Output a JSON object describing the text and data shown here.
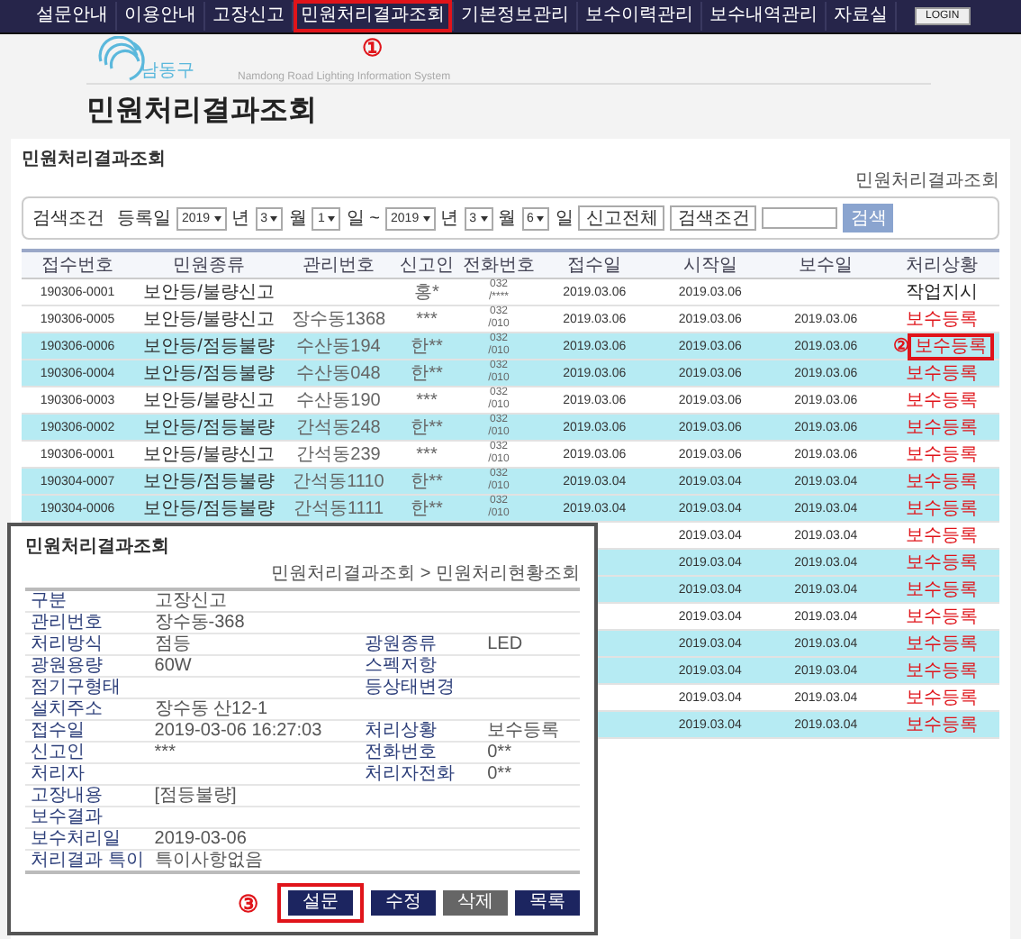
{
  "nav": {
    "items": [
      {
        "label": "설문안내",
        "outlined": false
      },
      {
        "label": "이용안내",
        "outlined": false
      },
      {
        "label": "고장신고",
        "outlined": false
      },
      {
        "label": "민원처리결과조회",
        "outlined": true
      },
      {
        "label": "기본정보관리",
        "outlined": false
      },
      {
        "label": "보수이력관리",
        "outlined": false
      },
      {
        "label": "보수내역관리",
        "outlined": false
      },
      {
        "label": "자료실",
        "outlined": false
      }
    ],
    "login": "LOGIN"
  },
  "markers": [
    "①",
    "②",
    "③"
  ],
  "logo": {
    "name": "남동구",
    "tagline": "Namdong Road Lighting Information System"
  },
  "page_title": "민원처리결과조회",
  "panel": {
    "title": "민원처리결과조회",
    "breadcrumb": "민원처리결과조회",
    "search": {
      "label": "검색조건",
      "date_label": "등록일",
      "from": [
        "2019",
        "년",
        "3",
        "월",
        "1",
        "일 ~"
      ],
      "to": [
        "2019",
        "년",
        "3",
        "월",
        "6",
        "일"
      ],
      "type": "신고전체",
      "condition": "검색조건",
      "button": "검색"
    },
    "table": {
      "columns": [
        "접수번호",
        "민원종류",
        "관리번호",
        "신고인",
        "전화번호",
        "접수일",
        "시작일",
        "보수일",
        "처리상황"
      ],
      "rows": [
        {
          "highlight": false,
          "no": "190306-0001",
          "type": "보안등/불량신고",
          "reporter": "홍*",
          "phone": "032\n/****",
          "received": "2019.03.06",
          "started": "2019.03.06",
          "status": "작업지시",
          "kind": "order",
          "outlined": false
        },
        {
          "highlight": false,
          "no": "190306-0005",
          "type": "보안등/불량신고",
          "manage": "장수동1368",
          "reporter": "***",
          "phone": "032\n/010",
          "received": "2019.03.06",
          "started": "2019.03.06",
          "repaired": "2019.03.06",
          "status": "보수등록",
          "kind": "repair",
          "outlined": false
        },
        {
          "highlight": true,
          "no": "190306-0006",
          "type": "보안등/점등불량",
          "manage": "수산동194",
          "reporter": "한**",
          "phone": "032\n/010",
          "received": "2019.03.06",
          "started": "2019.03.06",
          "repaired": "2019.03.06",
          "status": "보수등록",
          "kind": "repair",
          "outlined": true
        },
        {
          "highlight": true,
          "no": "190306-0004",
          "type": "보안등/점등불량",
          "manage": "수산동048",
          "reporter": "한**",
          "phone": "032\n/010",
          "received": "2019.03.06",
          "started": "2019.03.06",
          "repaired": "2019.03.06",
          "status": "보수등록",
          "kind": "repair",
          "outlined": false
        },
        {
          "highlight": false,
          "no": "190306-0003",
          "type": "보안등/불량신고",
          "manage": "수산동190",
          "reporter": "***",
          "phone": "032\n/010",
          "received": "2019.03.06",
          "started": "2019.03.06",
          "repaired": "2019.03.06",
          "status": "보수등록",
          "kind": "repair",
          "outlined": false
        },
        {
          "highlight": true,
          "no": "190306-0002",
          "type": "보안등/점등불량",
          "manage": "간석동248",
          "reporter": "한**",
          "phone": "032\n/010",
          "received": "2019.03.06",
          "started": "2019.03.06",
          "repaired": "2019.03.06",
          "status": "보수등록",
          "kind": "repair",
          "outlined": false
        },
        {
          "highlight": false,
          "no": "190306-0001",
          "type": "보안등/불량신고",
          "manage": "간석동239",
          "reporter": "***",
          "phone": "032\n/010",
          "received": "2019.03.06",
          "started": "2019.03.06",
          "repaired": "2019.03.06",
          "status": "보수등록",
          "kind": "repair",
          "outlined": false
        },
        {
          "highlight": true,
          "no": "190304-0007",
          "type": "보안등/점등불량",
          "manage": "간석동1110",
          "reporter": "한**",
          "phone": "032\n/010",
          "received": "2019.03.04",
          "started": "2019.03.04",
          "repaired": "2019.03.04",
          "status": "보수등록",
          "kind": "repair",
          "outlined": false
        },
        {
          "highlight": true,
          "no": "190304-0006",
          "type": "보안등/점등불량",
          "manage": "간석동1111",
          "reporter": "한**",
          "phone": "032\n/010",
          "received": "2019.03.04",
          "started": "2019.03.04",
          "repaired": "2019.03.04",
          "status": "보수등록",
          "kind": "repair",
          "outlined": false
        },
        {
          "highlight": false,
          "started": "2019.03.04",
          "repaired": "2019.03.04",
          "status": "보수등록",
          "kind": "repair",
          "outlined": false
        },
        {
          "highlight": true,
          "started": "2019.03.04",
          "repaired": "2019.03.04",
          "status": "보수등록",
          "kind": "repair",
          "outlined": false
        },
        {
          "highlight": true,
          "started": "2019.03.04",
          "repaired": "2019.03.04",
          "status": "보수등록",
          "kind": "repair",
          "outlined": false
        },
        {
          "highlight": false,
          "started": "2019.03.04",
          "repaired": "2019.03.04",
          "status": "보수등록",
          "kind": "repair",
          "outlined": false
        },
        {
          "highlight": true,
          "started": "2019.03.04",
          "repaired": "2019.03.04",
          "status": "보수등록",
          "kind": "repair",
          "outlined": false
        },
        {
          "highlight": true,
          "started": "2019.03.04",
          "repaired": "2019.03.04",
          "status": "보수등록",
          "kind": "repair",
          "outlined": false
        },
        {
          "highlight": false,
          "started": "2019.03.04",
          "repaired": "2019.03.04",
          "status": "보수등록",
          "kind": "repair",
          "outlined": false
        },
        {
          "highlight": true,
          "started": "2019.03.04",
          "repaired": "2019.03.04",
          "status": "보수등록",
          "kind": "repair",
          "outlined": false
        }
      ]
    }
  },
  "popup": {
    "title": "민원처리결과조회",
    "breadcrumb": "민원처리결과조회 > 민원처리현황조회",
    "fields": [
      [
        {
          "label": "구분",
          "value": "고장신고"
        }
      ],
      [
        {
          "label": "관리번호",
          "value": "장수동-368"
        }
      ],
      [
        {
          "label": "처리방식",
          "value": "점등"
        },
        {
          "label": "광원종류",
          "value": "LED"
        }
      ],
      [
        {
          "label": "광원용량",
          "value": "60W"
        },
        {
          "label": "스펙저항"
        }
      ],
      [
        {
          "label": "점기구형태"
        },
        {
          "label": "등상태변경"
        }
      ],
      [
        {
          "label": "설치주소",
          "value": "장수동 산12-1"
        }
      ],
      [
        {
          "label": "접수일",
          "value": "2019-03-06 16:27:03"
        },
        {
          "label": "처리상황",
          "value": "보수등록"
        }
      ],
      [
        {
          "label": "신고인",
          "value": "***"
        },
        {
          "label": "전화번호",
          "value": "0**"
        }
      ],
      [
        {
          "label": "처리자"
        },
        {
          "label": "처리자전화",
          "value": "0**"
        }
      ],
      [
        {
          "label": "고장내용",
          "value": "[점등불량]"
        }
      ],
      [
        {
          "label": "보수결과"
        }
      ],
      [
        {
          "label": "보수처리일",
          "value": "2019-03-06"
        }
      ],
      [
        {
          "label": "처리결과 특이",
          "value": "특이사항없음"
        }
      ]
    ],
    "buttons": [
      {
        "label": "설문",
        "kind": "primary",
        "outlined": true
      },
      {
        "label": "수정",
        "kind": "primary",
        "outlined": false
      },
      {
        "label": "삭제",
        "kind": "secondary",
        "outlined": false
      },
      {
        "label": "목록",
        "kind": "primary",
        "outlined": false
      }
    ]
  }
}
